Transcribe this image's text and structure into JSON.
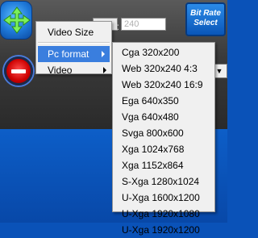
{
  "background_area": {
    "field_value": "240",
    "field_label_suffix": "l:",
    "bitrate_button": "Bit Rate Select"
  },
  "icons": {
    "move": "move-arrows-icon",
    "stop": "stop-icon",
    "submenu": "submenu-arrow-icon",
    "dropdown": "dropdown-arrow-icon"
  },
  "context_menu": {
    "items": [
      {
        "label": "Video Size"
      },
      {
        "label": "Pc format",
        "highlighted": true
      },
      {
        "label": "Video"
      }
    ]
  },
  "pc_format_submenu": {
    "items": [
      "Cga 320x200",
      "Web 320x240 4:3",
      "Web 320x240 16:9",
      "Ega 640x350",
      "Vga 640x480",
      "Svga 800x600",
      "Xga 1024x768",
      "Xga 1152x864",
      "S-Xga 1280x1024",
      "U-Xga 1600x1200",
      "U-Xga 1920x1080",
      "U-Xga 1920x1200"
    ]
  },
  "colors": {
    "highlight": "#3a7ede",
    "blue_background": "#0a52b8",
    "menu_background": "#f0f0f0"
  }
}
